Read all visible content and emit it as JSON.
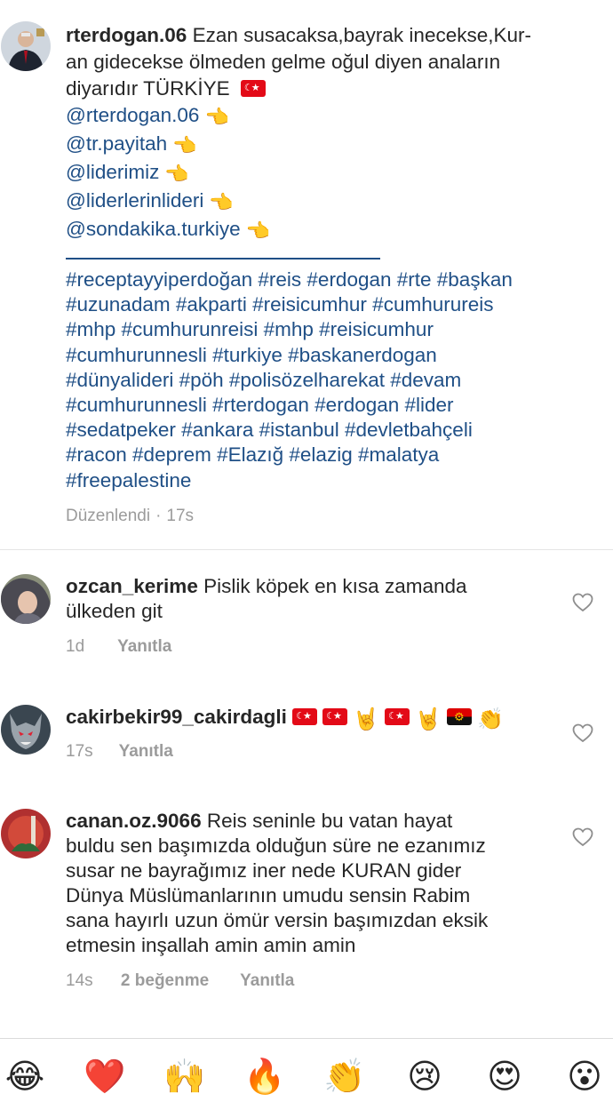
{
  "post": {
    "username": "rterdogan.06",
    "caption_lines": [
      "Ezan susacaksa,bayrak inecekse,Kur-",
      "an gidecekse ölmeden gelme oğul diyen anaların",
      "diyarıdır TÜRKİYE"
    ],
    "mentions": [
      "@rterdogan.06",
      "@tr.payitah",
      "@liderimiz",
      "@liderlerinlideri",
      "@sondakika.turkiye"
    ],
    "hashtag_lines": [
      "#receptayyiperdoğan #reis #erdogan #rte #başkan",
      "#uzunadam #akparti #reisicumhur  #cumhurureis",
      "#mhp #cumhurunreisi #mhp #reisicumhur",
      "#cumhurunnesli #turkiye #baskanerdogan",
      "#dünyalideri #pöh #polisözelharekat #devam",
      "#cumhurunnesli #rterdogan #erdogan #lider",
      "#sedatpeker #ankara #istanbul #devletbahçeli",
      "#racon #deprem #Elazığ #elazig #malatya",
      "#freepalestine"
    ],
    "edited_label": "Düzenlendi",
    "separator": "·",
    "time": "17s"
  },
  "comments": [
    {
      "username": "ozcan_kerime",
      "text_lines": [
        "Pislik köpek en kısa zamanda",
        "ülkeden git"
      ],
      "time": "1d",
      "reply_label": "Yanıtla"
    },
    {
      "username": "cakirbekir99_cakirdagli",
      "emoji_sequence": [
        "flag-tr",
        "flag-tr",
        "horns",
        "flag-tr",
        "horns",
        "flag-ao",
        "clap"
      ],
      "time": "17s",
      "reply_label": "Yanıtla"
    },
    {
      "username": "canan.oz.9066",
      "first_line": "Reis seninle bu vatan hayat",
      "text_lines": [
        "buldu sen başımızda olduğun süre ne ezanımız",
        "susar ne bayrağımız iner nede KURAN gider",
        "Dünya Müslümanlarının umudu sensin Rabim",
        "sana hayırlı uzun ömür versin başımızdan eksik",
        "etmesin inşallah amin amin amin"
      ],
      "time": "14s",
      "likes_label": "2 beğenme",
      "reply_label": "Yanıtla"
    }
  ],
  "emoji_bar": [
    {
      "name": "tears-of-joy",
      "glyph": "😂"
    },
    {
      "name": "red-heart",
      "glyph": "❤️"
    },
    {
      "name": "raising-hands",
      "glyph": "🙌"
    },
    {
      "name": "fire",
      "glyph": "🔥"
    },
    {
      "name": "clapping-hands",
      "glyph": "👏"
    },
    {
      "name": "crying-face",
      "glyph": "😢"
    },
    {
      "name": "heart-eyes",
      "glyph": "😍"
    },
    {
      "name": "astonished-face",
      "glyph": "😮"
    }
  ],
  "glyphs": {
    "point_left": "👈",
    "flag_tr": "🇹🇷",
    "horns": "🤘",
    "clap": "👏"
  },
  "colors": {
    "link": "#1f4f86",
    "meta": "#9b9b9b",
    "text": "#262626"
  }
}
